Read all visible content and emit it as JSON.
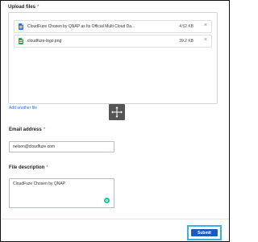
{
  "upload": {
    "label": "Upload files",
    "required_mark": "*",
    "files": [
      {
        "name": "CloudFuze Chosen by QNAP as Its Official Multi Cloud Da...",
        "size": "4.52 KB",
        "icon": "doc-file-icon",
        "icon_color": "#2a6fe0",
        "remove": "×"
      },
      {
        "name": "cloudfuze-logo.png",
        "size": "39.2 KB",
        "icon": "image-file-icon",
        "icon_color": "#31a24c",
        "remove": "×"
      }
    ],
    "add_link": "Add another file"
  },
  "email": {
    "label": "Email address",
    "required_mark": "*",
    "value": "nelson@cloudfuze.com"
  },
  "description": {
    "label": "File description",
    "required_mark": "*",
    "value": "CloudFuze Chosen by QNAP"
  },
  "submit": {
    "label": "Submit",
    "color": "#1b59c4",
    "highlight": "#3ab0e8"
  }
}
